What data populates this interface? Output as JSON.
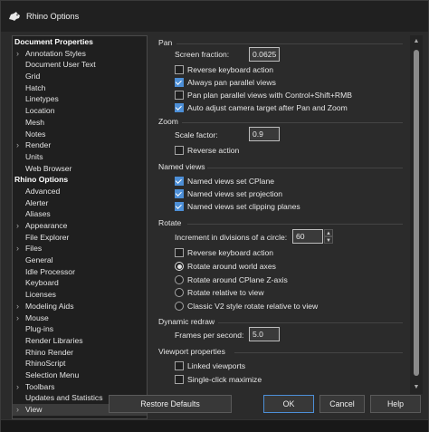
{
  "window": {
    "title": "Rhino Options"
  },
  "tree": {
    "items": [
      {
        "label": "Document Properties",
        "section": true
      },
      {
        "label": "Annotation Styles",
        "chevron": true
      },
      {
        "label": "Document User Text"
      },
      {
        "label": "Grid"
      },
      {
        "label": "Hatch"
      },
      {
        "label": "Linetypes"
      },
      {
        "label": "Location"
      },
      {
        "label": "Mesh"
      },
      {
        "label": "Notes"
      },
      {
        "label": "Render",
        "chevron": true
      },
      {
        "label": "Units"
      },
      {
        "label": "Web Browser"
      },
      {
        "label": "Rhino Options",
        "section": true
      },
      {
        "label": "Advanced"
      },
      {
        "label": "Alerter"
      },
      {
        "label": "Aliases"
      },
      {
        "label": "Appearance",
        "chevron": true
      },
      {
        "label": "File Explorer"
      },
      {
        "label": "Files",
        "chevron": true
      },
      {
        "label": "General"
      },
      {
        "label": "Idle Processor"
      },
      {
        "label": "Keyboard"
      },
      {
        "label": "Licenses"
      },
      {
        "label": "Modeling Aids",
        "chevron": true
      },
      {
        "label": "Mouse",
        "chevron": true
      },
      {
        "label": "Plug-ins"
      },
      {
        "label": "Render Libraries"
      },
      {
        "label": "Rhino Render"
      },
      {
        "label": "RhinoScript"
      },
      {
        "label": "Selection Menu"
      },
      {
        "label": "Toolbars",
        "chevron": true
      },
      {
        "label": "Updates and Statistics"
      },
      {
        "label": "View",
        "chevron": true,
        "selected": true
      }
    ]
  },
  "pan": {
    "title": "Pan",
    "screen_fraction_label": "Screen fraction:",
    "screen_fraction_value": "0.0625",
    "reverse_keyboard": "Reverse keyboard action",
    "always_pan_parallel": "Always pan parallel views",
    "pan_plan_parallel": "Pan plan parallel views with Control+Shift+RMB",
    "auto_adjust": "Auto adjust camera target after Pan and Zoom"
  },
  "zoom": {
    "title": "Zoom",
    "scale_factor_label": "Scale factor:",
    "scale_factor_value": "0.9",
    "reverse_action": "Reverse action"
  },
  "named_views": {
    "title": "Named views",
    "set_cplane": "Named views set CPlane",
    "set_projection": "Named views set projection",
    "set_clipping": "Named views set clipping planes"
  },
  "rotate": {
    "title": "Rotate",
    "increment_label": "Increment in divisions of a circle:",
    "increment_value": "60",
    "reverse_keyboard": "Reverse keyboard action",
    "around_world": "Rotate around world axes",
    "around_cplane": "Rotate around CPlane Z-axis",
    "relative_view": "Rotate relative to view",
    "classic_v2": "Classic V2 style rotate relative to view"
  },
  "dynamic_redraw": {
    "title": "Dynamic redraw",
    "fps_label": "Frames per second:",
    "fps_value": "5.0"
  },
  "viewport_properties": {
    "title": "Viewport properties",
    "linked": "Linked viewports",
    "single_click_maximize": "Single-click maximize"
  },
  "buttons": {
    "restore_defaults": "Restore Defaults",
    "ok": "OK",
    "cancel": "Cancel",
    "help": "Help"
  },
  "colors": {
    "accent": "#4d8fd7",
    "background": "#2b2b2b"
  }
}
